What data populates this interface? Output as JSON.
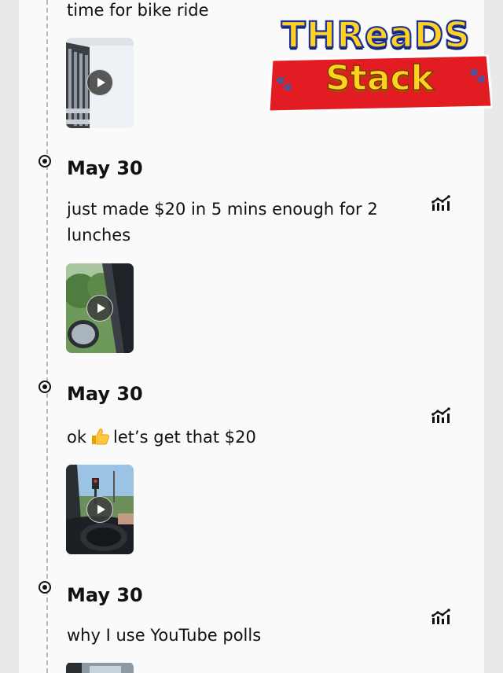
{
  "brand": {
    "title": "THReaDS",
    "subtitle": "Stack",
    "colors": {
      "text_fill": "#ffd21f",
      "outline": "#1b2f9a",
      "banner": "#e31b23"
    }
  },
  "posts": [
    {
      "date": "",
      "text": "time for bike ride",
      "has_video": true
    },
    {
      "date": "May 30",
      "text": "just made $20 in 5 mins enough for 2 lunches",
      "has_video": true
    },
    {
      "date": "May 30",
      "text_before": "ok",
      "emoji": "thumbs-up",
      "text_after": "let’s get that $20",
      "has_video": true
    },
    {
      "date": "May 30",
      "text": "why I use YouTube polls",
      "has_video": true
    }
  ],
  "icons": {
    "stats": "analytics-icon",
    "play": "play-icon",
    "timeline_dot": "radio-dot-icon"
  }
}
